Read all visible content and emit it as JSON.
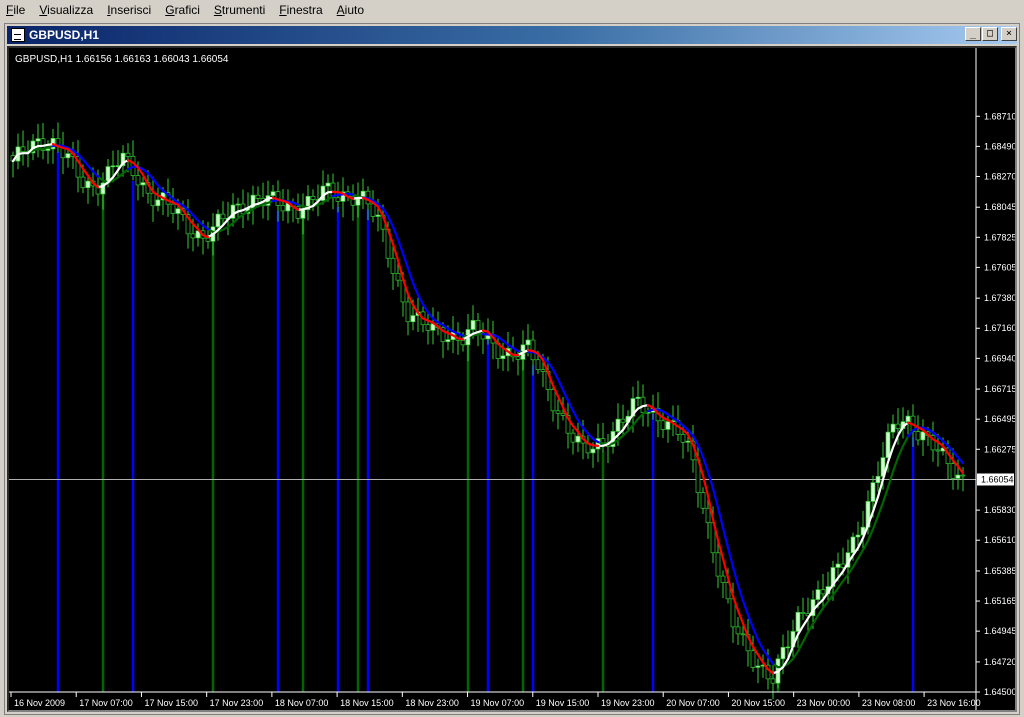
{
  "menubar": {
    "items": [
      "File",
      "Visualizza",
      "Inserisci",
      "Grafici",
      "Strumenti",
      "Finestra",
      "Aiuto"
    ]
  },
  "window": {
    "title": "GBPUSD,H1",
    "controls": [
      "minimize",
      "maximize",
      "close"
    ]
  },
  "chart": {
    "header": "GBPUSD,H1  1.66156 1.66163 1.66043 1.66054",
    "current_price": "1.66054",
    "colors": {
      "background": "#000000",
      "bull": "#ccffcc",
      "wick": "#33cc33",
      "blue": "#0000ff",
      "red": "#ff0000",
      "white": "#ffffff",
      "green": "#006600",
      "axis": "#ffffff"
    }
  },
  "chart_data": {
    "type": "candlestick",
    "symbol": "GBPUSD",
    "timeframe": "H1",
    "ohlc_last": [
      1.66156,
      1.66163,
      1.66043,
      1.66054
    ],
    "ylim": [
      1.645,
      1.6899
    ],
    "y_ticks": [
      "1.68710",
      "1.68490",
      "1.68270",
      "1.68045",
      "1.67825",
      "1.67605",
      "1.67380",
      "1.67160",
      "1.66940",
      "1.66715",
      "1.66495",
      "1.66275",
      "1.66054",
      "1.65830",
      "1.65610",
      "1.65385",
      "1.65165",
      "1.64945",
      "1.64720",
      "1.64500"
    ],
    "x_ticks": [
      "16 Nov 2009",
      "17 Nov 07:00",
      "17 Nov 15:00",
      "17 Nov 23:00",
      "18 Nov 07:00",
      "18 Nov 15:00",
      "18 Nov 23:00",
      "19 Nov 07:00",
      "19 Nov 15:00",
      "19 Nov 23:00",
      "20 Nov 07:00",
      "20 Nov 15:00",
      "23 Nov 00:00",
      "23 Nov 08:00",
      "23 Nov 16:00"
    ],
    "close_path": [
      1.6835,
      1.6848,
      1.6855,
      1.685,
      1.684,
      1.6825,
      1.682,
      1.6828,
      1.684,
      1.683,
      1.6815,
      1.6808,
      1.68,
      1.679,
      1.6783,
      1.679,
      1.68,
      1.6808,
      1.6812,
      1.6808,
      1.6804,
      1.6805,
      1.681,
      1.6815,
      1.6812,
      1.6815,
      1.681,
      1.679,
      1.676,
      1.673,
      1.672,
      1.6712,
      1.6712,
      1.671,
      1.6715,
      1.6705,
      1.67,
      1.6698,
      1.67,
      1.668,
      1.666,
      1.664,
      1.6625,
      1.663,
      1.664,
      1.665,
      1.666,
      1.6655,
      1.665,
      1.664,
      1.662,
      1.658,
      1.654,
      1.65,
      1.648,
      1.647,
      1.6462,
      1.6482,
      1.6505,
      1.652,
      1.653,
      1.654,
      1.656,
      1.659,
      1.662,
      1.6645,
      1.6648,
      1.664,
      1.6628,
      1.6612,
      1.6606
    ],
    "candle_count": 191,
    "indicators": [
      {
        "type": "moving-average",
        "color": "white"
      },
      {
        "type": "moving-average",
        "color": "blue"
      },
      {
        "type": "moving-average",
        "color": "red"
      },
      {
        "type": "moving-average",
        "color": "green"
      },
      {
        "type": "histogram",
        "colors": [
          "blue",
          "green"
        ]
      }
    ]
  }
}
